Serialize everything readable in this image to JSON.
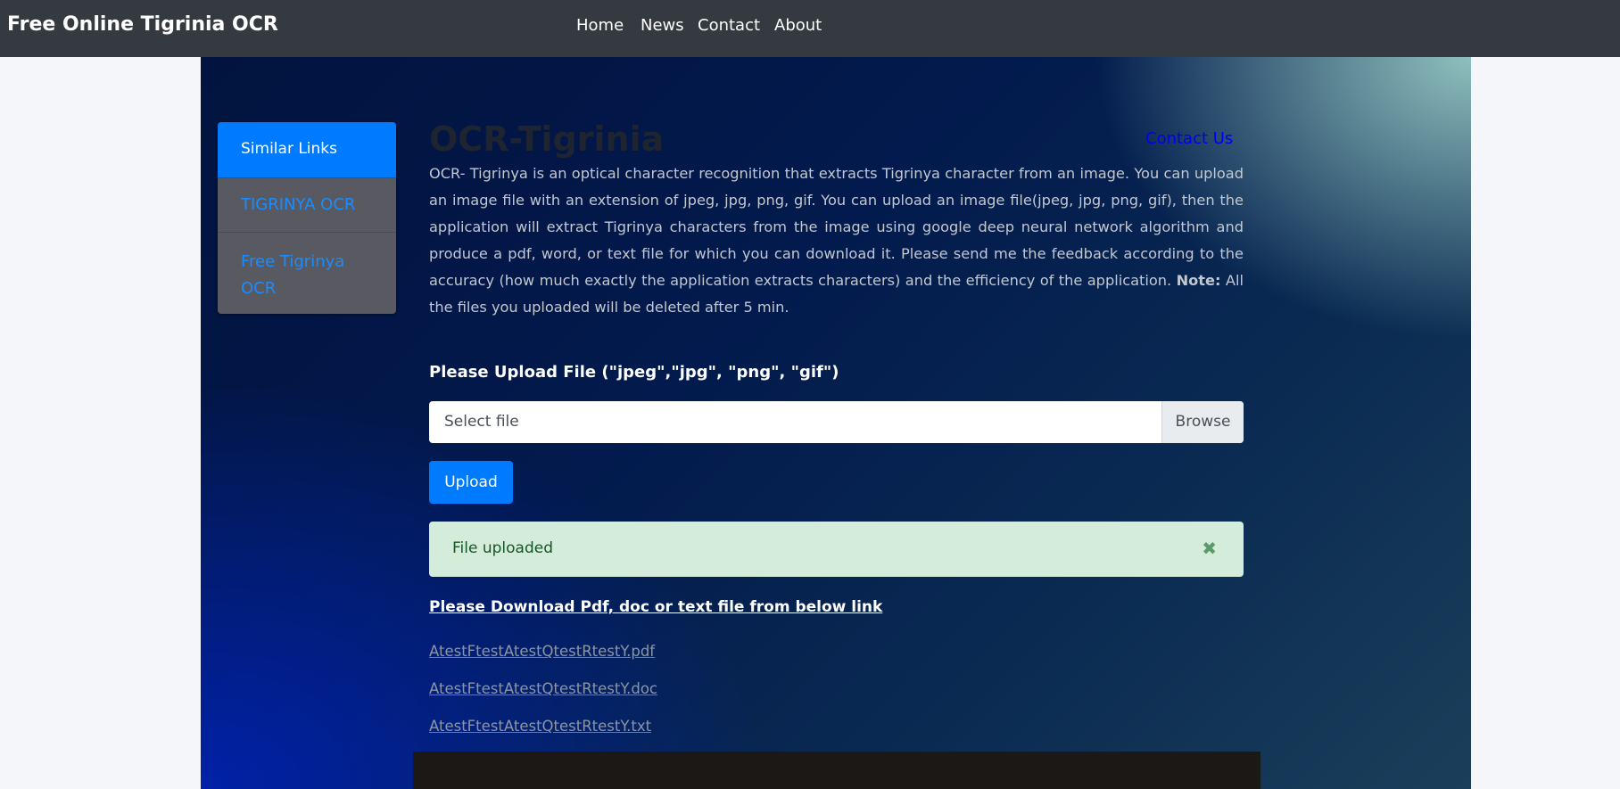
{
  "navbar": {
    "brand": "Free Online Tigrinia OCR",
    "links": [
      "Home",
      "News",
      "Contact",
      "About"
    ]
  },
  "sidebar": {
    "header": "Similar Links",
    "items": [
      "TIGRINYA OCR",
      "Free Tigrinya OCR"
    ]
  },
  "main": {
    "title": "OCR-Tigrinia",
    "contact_link": "Contact Us",
    "intro": "OCR- Tigrinya is an optical character recognition that extracts Tigrinya character from an image. You can upload an image file with an extension of jpeg, jpg, png, gif. You can upload an image file(jpeg, jpg, png, gif), then the application will extract Tigrinya characters from the image using google deep neural network algorithm and produce a pdf, word, or text file for which you can download it. Please send me the feedback according to the accuracy (how much exactly the application extracts characters) and the efficiency of the application.",
    "note_label": "Note:",
    "note_text": "All the files you uploaded will be deleted after 5 min.",
    "upload_label": "Please Upload File (\"jpeg\",\"jpg\", \"png\", \"gif\")",
    "file_placeholder": "Select file",
    "browse_label": "Browse",
    "upload_button": "Upload",
    "alert_text": "File uploaded",
    "alert_close": "✖",
    "download_label": "Please Download Pdf, doc or text file from below link",
    "downloads": [
      "AtestFtestAtestQtestRtestY.pdf",
      "AtestFtestAtestQtestRtestY.doc",
      "AtestFtestAtestQtestRtestY.txt"
    ]
  },
  "colors": {
    "navbar": "#343a40",
    "primary": "#007bff",
    "sidebar": "#595a61",
    "alert_bg": "#d4edda",
    "alert_text": "#155724",
    "footer": "#1c1816"
  }
}
